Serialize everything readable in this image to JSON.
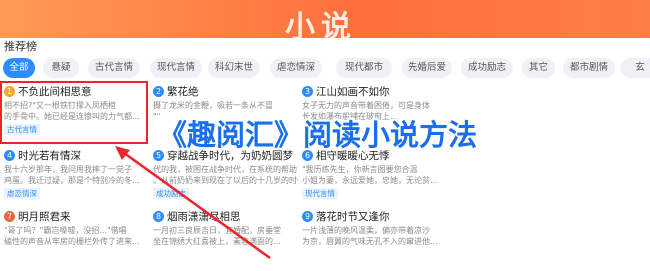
{
  "header": {
    "title": "小说"
  },
  "section": {
    "title": "推荐榜"
  },
  "tabs": [
    "全部",
    "悬疑",
    "古代言情",
    "现代言情",
    "科幻末世",
    "虐恋情深",
    "现代都市",
    "先婚后爱",
    "成功励志",
    "其它",
    "都市剧情",
    "玄"
  ],
  "active_tab": 0,
  "books": [
    {
      "rank": "1",
      "title": "不负此间相思意",
      "desc": [
        "相不招?\"又一根铁钉撑入凤栖棺",
        "的手骨中。她已经是连惨叫的力气都..."
      ],
      "tag": "古代言情"
    },
    {
      "rank": "2",
      "title": "繁花绝",
      "desc": [
        "摄了龙米的金鞭，吸若一条从不冒",
        "\"\""
      ],
      "tag": ""
    },
    {
      "rank": "3",
      "title": "江山如画不如你",
      "desc": [
        "女子无力的声音带着困倦，可是身体",
        "长发如瀑布般铺在玻窗上..."
      ],
      "tag": ""
    },
    {
      "rank": "4",
      "title": "时光若有情深",
      "desc": [
        "我十六岁那年，我问用我摔了一觉子",
        "鸡蛋。我迁过疑，那是个特别冷的冬..."
      ],
      "tag": "虐恋情深"
    },
    {
      "rank": "5",
      "title": "穿越战争时代，为奶奶圆梦",
      "desc": [
        "代的我，被困在战争时代，在系统的帮助下，我穿",
        "。从前奶奶来到现在了以后的十几岁的时代，在..."
      ],
      "tag": "成功励志"
    },
    {
      "rank": "6",
      "title": "相守暖暖心无悸",
      "desc": [
        "\"我历练先生，你新言图要您合温",
        "小姐为妻，永远爱她，忠她，无论贫..."
      ],
      "tag": "现代言情"
    },
    {
      "rank": "7",
      "title": "明月照君来",
      "desc": [
        "\"哥了吗？\"霸岂嗓嘘，没招...\"借唱",
        "磕性的声音从牢房的栅栏外传了进来..."
      ],
      "tag": ""
    },
    {
      "rank": "8",
      "title": "烟雨潇潇尽相思",
      "desc": [
        "一月初三良辰吉日，宜婚配，房垂堂",
        "坐在锦绣大红喜被上，素容满面的..."
      ],
      "tag": ""
    },
    {
      "rank": "9",
      "title": "落花时节又逢你",
      "desc": [
        "一片浅薄的晚风温柔，偏亦带着凉沙",
        "为京，唇翼的气味无孔不入的窜进他..."
      ],
      "tag": ""
    }
  ],
  "overlay": {
    "caption": "《趣阅汇》阅读小说方法"
  },
  "colors": {
    "accent": "#2d8cff",
    "header": "#ff6f3c",
    "highlight": "#e8262c"
  }
}
